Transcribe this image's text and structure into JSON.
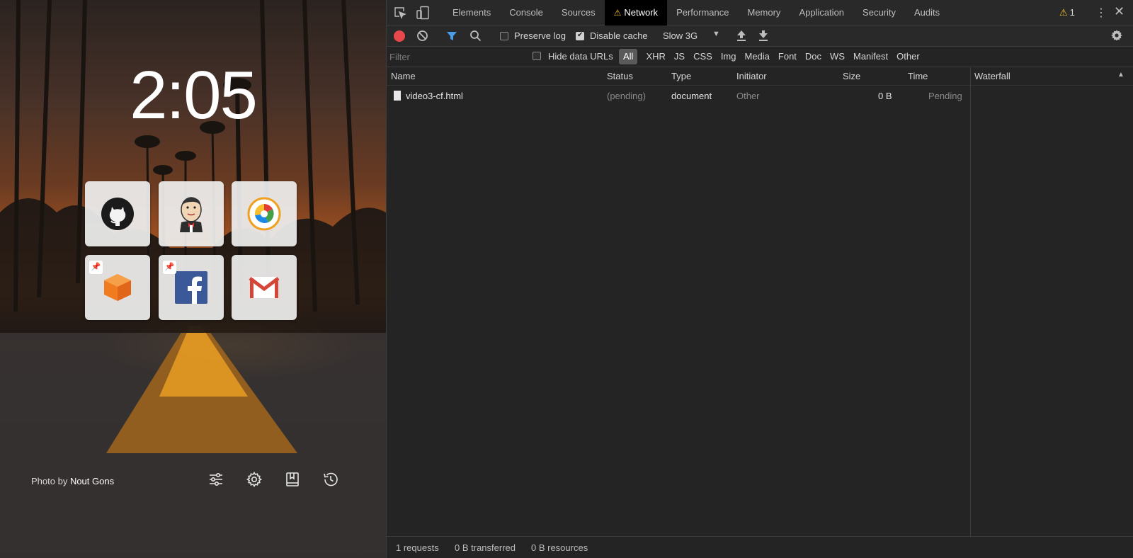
{
  "newtab": {
    "clock": "2:05",
    "photo_credit_prefix": "Photo by ",
    "photo_credit_author": "Nout Gons",
    "tiles": [
      {
        "name": "github",
        "pinned": false
      },
      {
        "name": "jenkins",
        "pinned": false
      },
      {
        "name": "chromium",
        "pinned": false
      },
      {
        "name": "box",
        "pinned": true
      },
      {
        "name": "facebook",
        "pinned": true
      },
      {
        "name": "gmail",
        "pinned": false
      }
    ],
    "footer_icons": [
      "sliders-icon",
      "gear-icon",
      "bookmarks-icon",
      "history-icon"
    ]
  },
  "devtools": {
    "tabs": [
      "Elements",
      "Console",
      "Sources",
      "Network",
      "Performance",
      "Memory",
      "Application",
      "Security",
      "Audits"
    ],
    "active_tab": "Network",
    "warning_count": "1",
    "toolbar": {
      "preserve_log": "Preserve log",
      "disable_cache": "Disable cache",
      "throttle": "Slow 3G"
    },
    "filter": {
      "placeholder": "Filter",
      "hide_data_urls": "Hide data URLs",
      "types": [
        "All",
        "XHR",
        "JS",
        "CSS",
        "Img",
        "Media",
        "Font",
        "Doc",
        "WS",
        "Manifest",
        "Other"
      ]
    },
    "columns": {
      "name": "Name",
      "status": "Status",
      "type": "Type",
      "initiator": "Initiator",
      "size": "Size",
      "time": "Time",
      "waterfall": "Waterfall"
    },
    "rows": [
      {
        "name": "video3-cf.html",
        "status": "(pending)",
        "type": "document",
        "initiator": "Other",
        "size": "0 B",
        "time": "Pending"
      }
    ],
    "status": {
      "requests": "1 requests",
      "transferred": "0 B transferred",
      "resources": "0 B resources"
    }
  }
}
